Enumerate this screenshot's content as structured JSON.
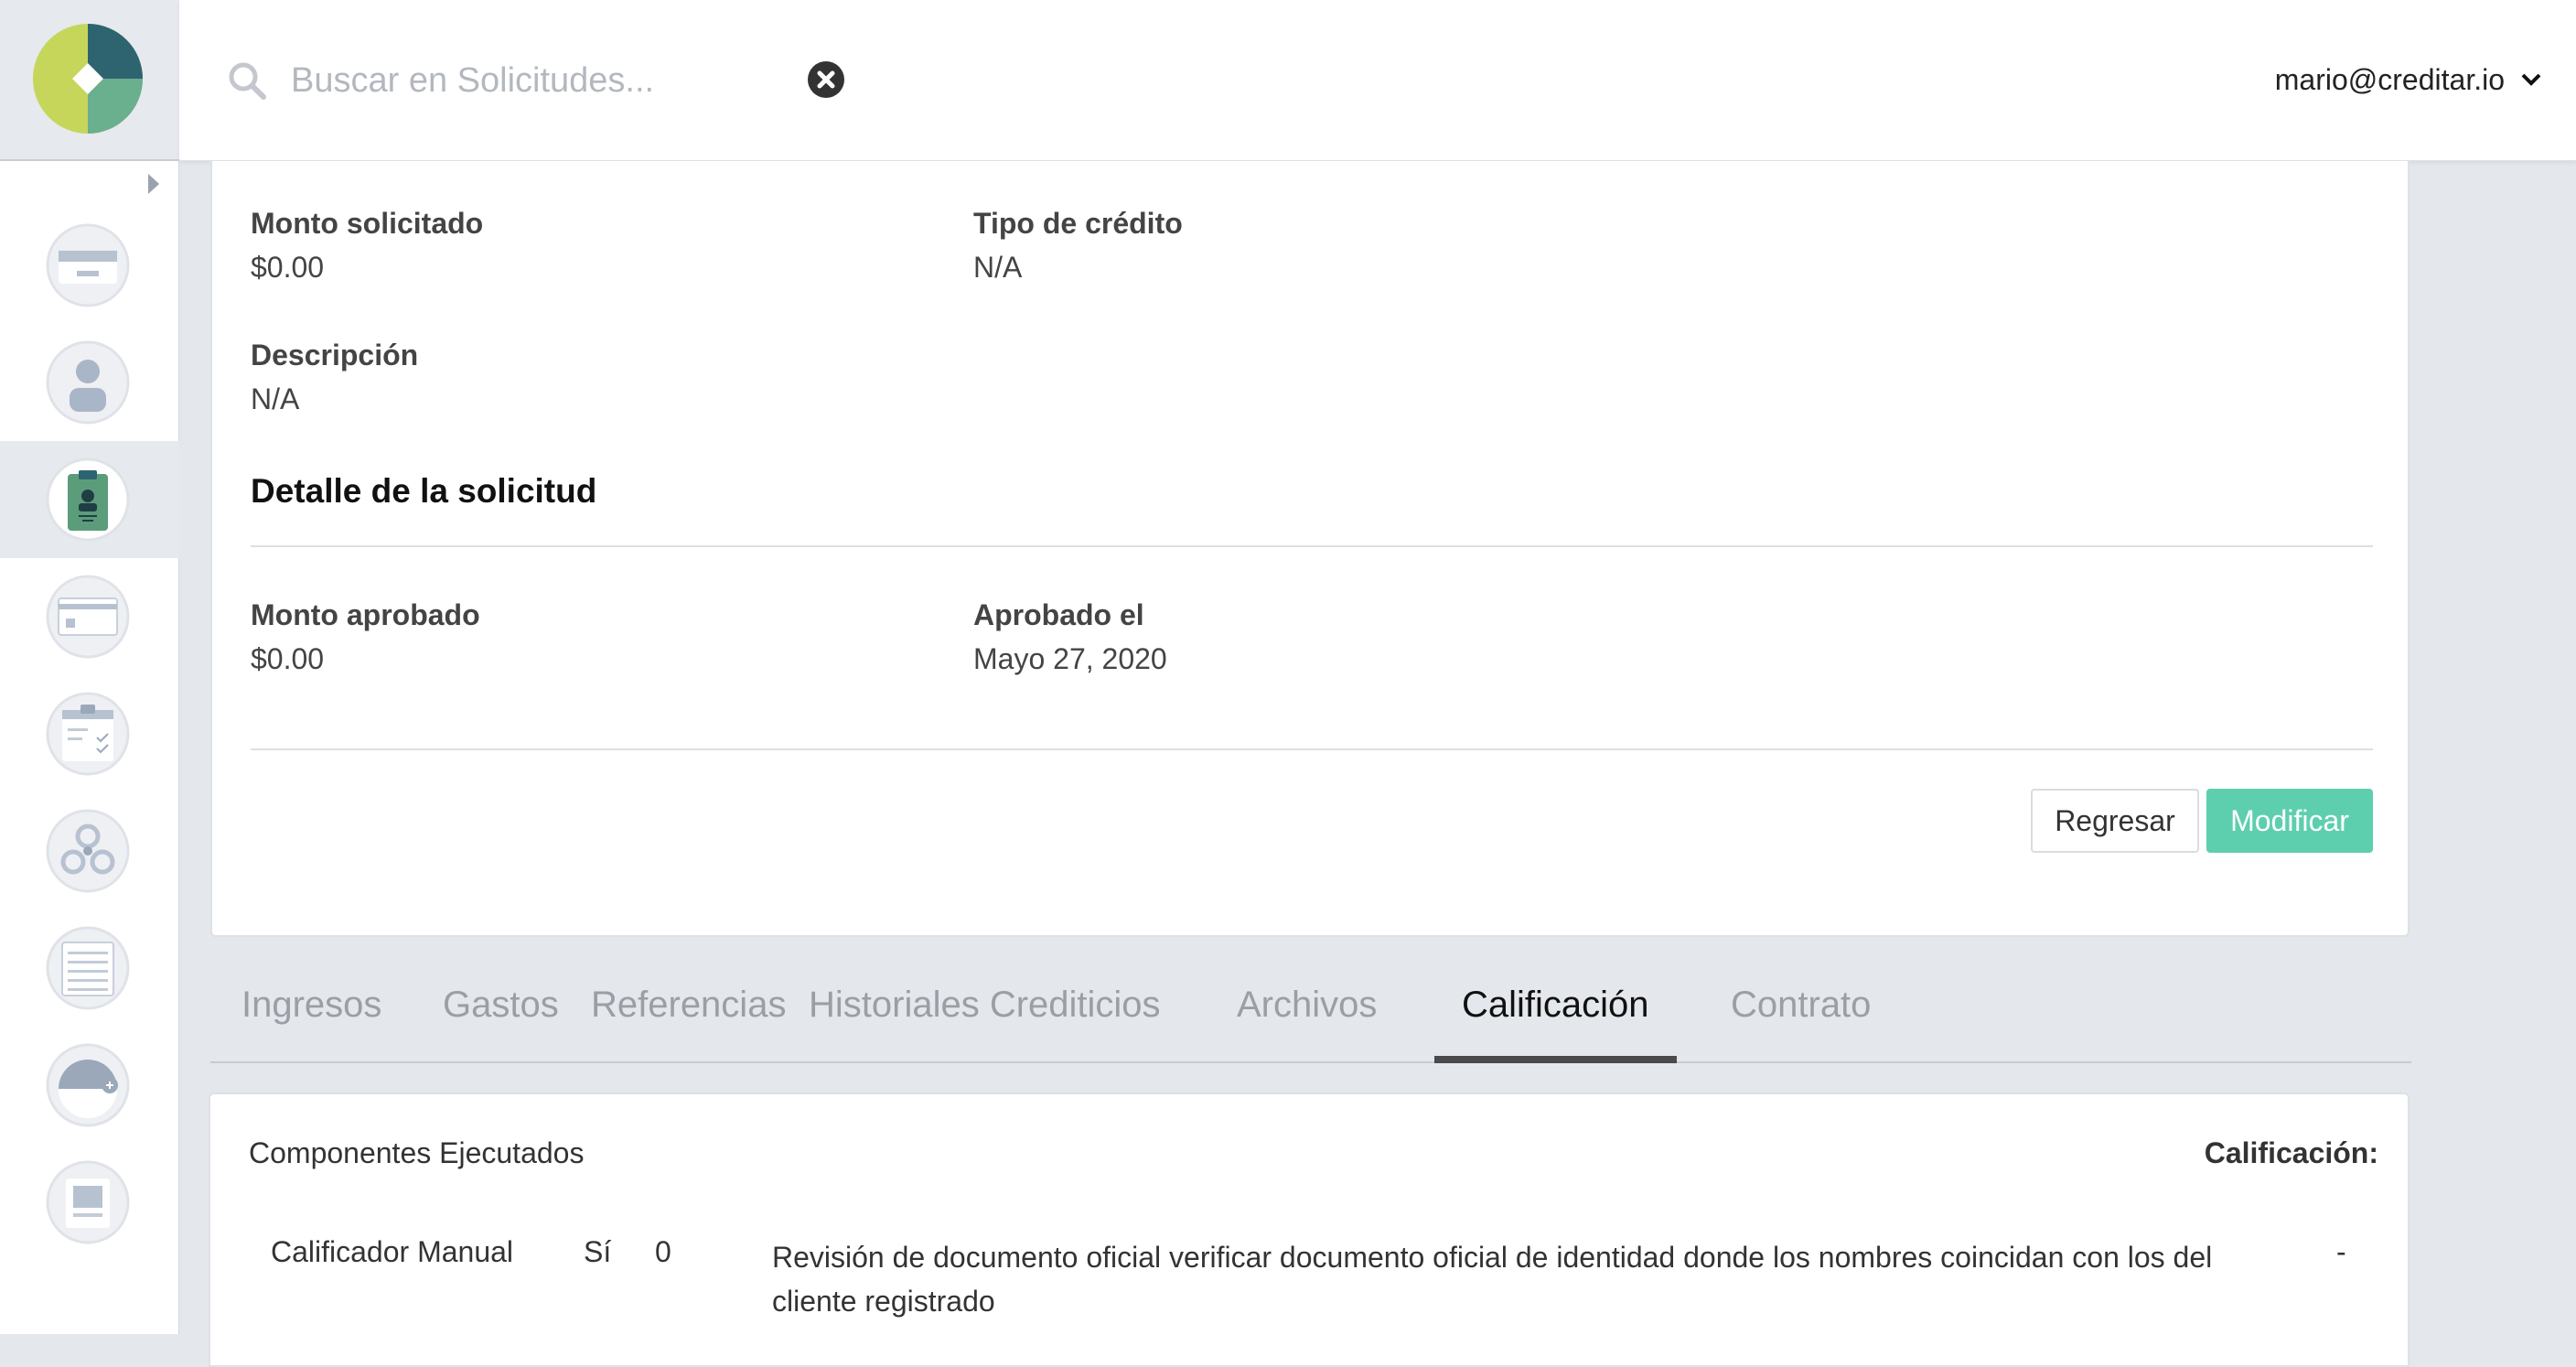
{
  "search": {
    "placeholder": "Buscar en Solicitudes..."
  },
  "user": {
    "email": "mario@creditar.io"
  },
  "sidebar": {
    "items": [
      {
        "icon": "card-icon",
        "active": false
      },
      {
        "icon": "user-icon",
        "active": false
      },
      {
        "icon": "clipboard-user-icon",
        "active": true
      },
      {
        "icon": "payment-card-icon",
        "active": false
      },
      {
        "icon": "checklist-icon",
        "active": false
      },
      {
        "icon": "webhook-icon",
        "active": false
      },
      {
        "icon": "list-icon",
        "active": false
      },
      {
        "icon": "gauge-add-icon",
        "active": false
      },
      {
        "icon": "document-icon",
        "active": false
      }
    ]
  },
  "request": {
    "monto_solicitado_label": "Monto solicitado",
    "monto_solicitado_value": "$0.00",
    "tipo_credito_label": "Tipo de crédito",
    "tipo_credito_value": "N/A",
    "descripcion_label": "Descripción",
    "descripcion_value": "N/A",
    "detail_title": "Detalle de la solicitud",
    "monto_aprobado_label": "Monto aprobado",
    "monto_aprobado_value": "$0.00",
    "aprobado_el_label": "Aprobado el",
    "aprobado_el_value": "Mayo 27, 2020",
    "back_label": "Regresar",
    "modify_label": "Modificar"
  },
  "tabs": [
    {
      "label": "Ingresos",
      "active": false
    },
    {
      "label": "Gastos",
      "active": false
    },
    {
      "label": "Referencias",
      "active": false
    },
    {
      "label": "Historiales Crediticios",
      "active": false
    },
    {
      "label": "Archivos",
      "active": false
    },
    {
      "label": "Calificación",
      "active": true
    },
    {
      "label": "Contrato",
      "active": false
    }
  ],
  "panel": {
    "title": "Componentes Ejecutados",
    "score_label": "Calificación:",
    "rows": [
      {
        "name": "Calificador Manual",
        "executed": "Sí",
        "score": "0",
        "description": "Revisión de documento oficial verificar documento oficial de identidad donde los nombres coincidan con los del cliente registrado",
        "result": "-"
      }
    ]
  },
  "colors": {
    "accent": "#5ecfae",
    "logo_green_light": "#c6d65a",
    "logo_teal_dark": "#2e6470",
    "logo_green_mid": "#6aaf8e",
    "active_nav_icon": "#5b9d7a"
  }
}
